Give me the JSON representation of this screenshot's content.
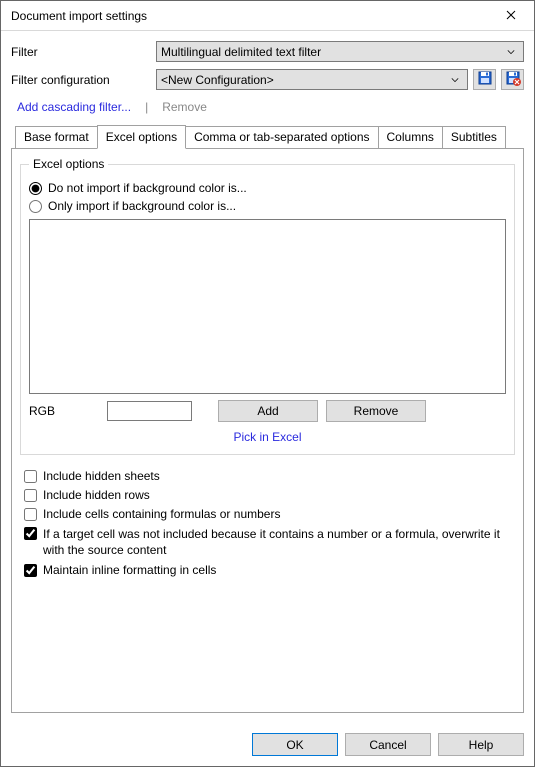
{
  "window": {
    "title": "Document import settings"
  },
  "form": {
    "filter_label": "Filter",
    "filter_value": "Multilingual delimited text filter",
    "config_label": "Filter configuration",
    "config_value": "<New Configuration>"
  },
  "links": {
    "add_cascading": "Add cascading filter...",
    "separator": "|",
    "remove": "Remove"
  },
  "tabs": {
    "items": [
      {
        "label": "Base format"
      },
      {
        "label": "Excel options"
      },
      {
        "label": "Comma or tab-separated options"
      },
      {
        "label": "Columns"
      },
      {
        "label": "Subtitles"
      }
    ]
  },
  "excel": {
    "legend": "Excel options",
    "radio_not_import": "Do not import if background color is...",
    "radio_only_import": "Only import if background color is...",
    "rgb_label": "RGB",
    "rgb_value": "",
    "add_btn": "Add",
    "remove_btn": "Remove",
    "pick_link": "Pick in Excel"
  },
  "checks": {
    "hidden_sheets": "Include hidden sheets",
    "hidden_rows": "Include hidden rows",
    "include_formulas": "Include cells containing formulas or numbers",
    "overwrite_sub": "If a target cell was not included because it contains a number or a formula, overwrite it with the source content",
    "maintain_inline": "Maintain inline formatting in cells"
  },
  "footer": {
    "ok": "OK",
    "cancel": "Cancel",
    "help": "Help"
  },
  "icons": {
    "close": "close-icon",
    "chevron_down": "chevron-down-icon",
    "save": "save-icon",
    "save_alt": "save-remove-icon"
  }
}
